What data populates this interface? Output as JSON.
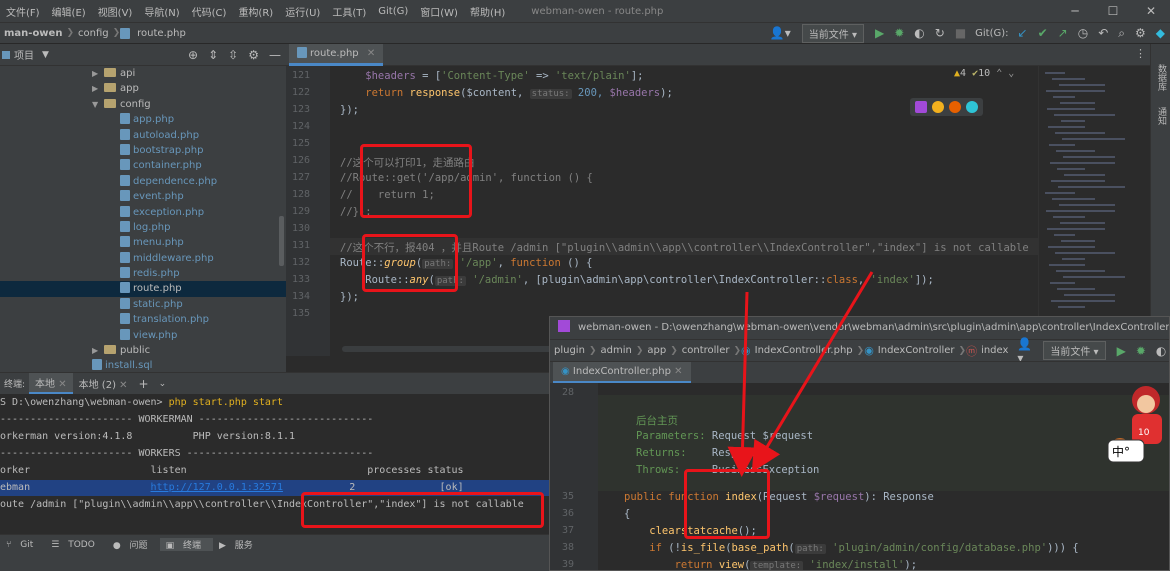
{
  "menu": [
    "文件(F)",
    "编辑(E)",
    "视图(V)",
    "导航(N)",
    "代码(C)",
    "重构(R)",
    "运行(U)",
    "工具(T)",
    "Git(G)",
    "窗口(W)",
    "帮助(H)"
  ],
  "window_title": "webman-owen - route.php",
  "nav": {
    "project": "man-owen",
    "folder": "config",
    "file": "route.php",
    "run_config": "当前文件",
    "git_label": "Git(G):"
  },
  "project_panel": {
    "title": "项目",
    "tree": [
      {
        "label": "api",
        "type": "folder",
        "indent": 92
      },
      {
        "label": "app",
        "type": "folder",
        "indent": 92
      },
      {
        "label": "config",
        "type": "folder-open",
        "indent": 92
      },
      {
        "label": "app.php",
        "type": "php",
        "indent": 120
      },
      {
        "label": "autoload.php",
        "type": "php",
        "indent": 120
      },
      {
        "label": "bootstrap.php",
        "type": "php",
        "indent": 120
      },
      {
        "label": "container.php",
        "type": "php",
        "indent": 120
      },
      {
        "label": "dependence.php",
        "type": "php",
        "indent": 120
      },
      {
        "label": "event.php",
        "type": "php",
        "indent": 120
      },
      {
        "label": "exception.php",
        "type": "php",
        "indent": 120
      },
      {
        "label": "log.php",
        "type": "php",
        "indent": 120
      },
      {
        "label": "menu.php",
        "type": "php",
        "indent": 120
      },
      {
        "label": "middleware.php",
        "type": "php",
        "indent": 120
      },
      {
        "label": "redis.php",
        "type": "php",
        "indent": 120
      },
      {
        "label": "route.php",
        "type": "php",
        "indent": 120,
        "selected": true
      },
      {
        "label": "static.php",
        "type": "php",
        "indent": 120
      },
      {
        "label": "translation.php",
        "type": "php",
        "indent": 120
      },
      {
        "label": "view.php",
        "type": "php",
        "indent": 120
      },
      {
        "label": "public",
        "type": "folder",
        "indent": 92
      },
      {
        "label": "install.sql",
        "type": "file",
        "indent": 92
      }
    ]
  },
  "editor": {
    "tab": "route.php",
    "inspections": {
      "warnings": "4",
      "weak": "10"
    },
    "line_numbers": [
      "121",
      "122",
      "123",
      "124",
      "125",
      "126",
      "127",
      "128",
      "129",
      "130",
      "131",
      "132",
      "133",
      "134",
      "135"
    ]
  },
  "code_text": {
    "l121a": "    $headers",
    "l121b": " = [",
    "l121c": "'Content-Type'",
    "l121d": " => ",
    "l121e": "'text/plain'",
    "l121f": "];",
    "l122a": "    return ",
    "l122b": "response",
    "l122c": "($content, ",
    "l122h": "status:",
    "l122d": " 200, ",
    "l122e": "$headers",
    "l122f": ");",
    "l123": "});",
    "l126": "//这个可以打印1，走通路由",
    "l127": "//Route::get('/app/admin', function () {",
    "l128": "//    return 1;",
    "l129": "//});",
    "l131": "//这个不行，报404 ，并且Route /admin [\"plugin\\\\admin\\\\app\\\\controller\\\\IndexController\",\"index\"] is not callable",
    "l132a": "Route::",
    "l132b": "group",
    "l132c": "(",
    "l132h": "path:",
    "l132d": " '/app'",
    "l132e": ", ",
    "l132f": "function",
    "l132g": " () {",
    "l133a": "    Route::",
    "l133b": "any",
    "l133c": "(",
    "l133h": "path:",
    "l133d": " '/admin'",
    "l133e": ", [plugin\\admin\\app\\controller\\IndexController::",
    "l133f": "class",
    "l133g": ", ",
    "l133i": "'index'",
    "l133j": "]);",
    "l134": "});"
  },
  "terminal": {
    "label": "终端:",
    "tab1": "本地",
    "tab2": "本地 (2)",
    "lines": [
      "S D:\\owenzhang\\webman-owen> php start.php start",
      "---------------------- WORKERMAN -----------------------------",
      "orkerman version:4.1.8          PHP version:8.1.1",
      "---------------------- WORKERS -------------------------------",
      "orker                    listen                              processes status",
      "ebman                    ",
      "oute /admin [\"plugin\\\\admin\\\\app\\\\controller\\\\IndexController\",\"index\"] is not callable"
    ],
    "cmd_prefix": "S D:\\owenzhang\\webman-owen> ",
    "cmd": "php start.php start",
    "link": "http://127.0.0.1:32571",
    "proc": "2",
    "status": "[ok]"
  },
  "statusbar": [
    "Git",
    "TODO",
    "问题",
    "终端",
    "服务"
  ],
  "popup": {
    "title": "webman-owen - D:\\owenzhang\\webman-owen\\vendor\\webman\\admin\\src\\plugin\\admin\\app\\controller\\IndexController.php",
    "crumbs": [
      "plugin",
      "admin",
      "app",
      "controller",
      "IndexController.php",
      "IndexController",
      "index"
    ],
    "run_config": "当前文件",
    "tab": "IndexController.php",
    "line_numbers": [
      "28",
      "",
      "",
      "",
      "",
      "35",
      "36",
      "37",
      "38",
      "39"
    ],
    "doc": {
      "title": "后台主页",
      "params_label": "Parameters:",
      "params": "Request $request",
      "returns_label": "Returns:",
      "returns": "Response",
      "throws_label": "Throws:",
      "throws": "BusinessException"
    },
    "code": {
      "l35a": "public ",
      "l35b": "function ",
      "l35c": "index",
      "l35d": "(Request ",
      "l35e": "$request",
      "l35f": "): Response",
      "l36": "{",
      "l37a": "    clearstatcache",
      "l37b": "();",
      "l38a": "    if ",
      "l38b": "(!",
      "l38c": "is_file",
      "l38d": "(",
      "l38e": "base_path",
      "l38f": "(",
      "l38h": "path:",
      "l38g": " 'plugin/admin/config/database.php'",
      "l38i": "))) {",
      "l39a": "        return ",
      "l39b": "view",
      "l39c": "(",
      "l39h": "template:",
      "l39d": " 'index/install'",
      "l39e": ");"
    }
  },
  "right_labels": [
    "数据库",
    "通知"
  ],
  "colors": {
    "accent": "#4a88c7",
    "annotation": "#e8141a"
  }
}
